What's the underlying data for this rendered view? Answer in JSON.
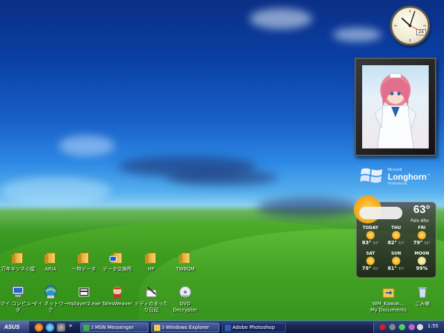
{
  "desktop": {
    "icons_row1": [
      {
        "label": "万年キツネ小屋",
        "icon": "folder-icon"
      },
      {
        "label": "ARIA",
        "icon": "folder-icon"
      },
      {
        "label": "一時データ",
        "icon": "folder-icon"
      },
      {
        "label": "データ交換所",
        "icon": "folder-shortcut-icon"
      },
      {
        "label": "HP",
        "icon": "folder-icon"
      },
      {
        "label": "TWBGM",
        "icon": "folder-icon"
      }
    ],
    "icons_row2": [
      {
        "label": "マイ コンピュータ",
        "icon": "my-computer-icon"
      },
      {
        "label": "マイ ネットワーク",
        "icon": "network-icon"
      },
      {
        "label": "mplayer2.exe",
        "icon": "media-player-icon"
      },
      {
        "label": "TalesWeaver",
        "icon": "talesweaver-icon"
      },
      {
        "label": "ミディのまったり日記",
        "icon": "diary-icon"
      },
      {
        "label": "DVD Decrypter",
        "icon": "dvd-icon"
      }
    ],
    "right_icons": [
      {
        "label": "WM_Kawak... My Documents",
        "icon": "my-documents-icon"
      },
      {
        "label": "ごみ箱",
        "icon": "recycle-bin-icon"
      }
    ]
  },
  "clock_widget": {
    "date": "24"
  },
  "longhorn_logo": {
    "brand_small": "Microsoft",
    "brand_big": "Longhorn",
    "tm": "™",
    "edition": "Professional"
  },
  "weather": {
    "current_temp": "63°",
    "city": "Palo Alto",
    "days": [
      {
        "name": "TODAY",
        "hi": "83°",
        "lo": "54°"
      },
      {
        "name": "THU",
        "hi": "82°",
        "lo": "53°"
      },
      {
        "name": "FRI",
        "hi": "79°",
        "lo": "54°"
      },
      {
        "name": "SAT",
        "hi": "79°",
        "lo": "55°"
      },
      {
        "name": "SUN",
        "hi": "81°",
        "lo": "55°"
      },
      {
        "name": "MOON",
        "hi": "99%",
        "lo": ""
      }
    ]
  },
  "taskbar": {
    "start_label": "ASUS",
    "overflow": "»",
    "tasks": [
      {
        "count": "3",
        "label": "MSN Messenger",
        "active": false
      },
      {
        "count": "3",
        "label": "Windows Explorer",
        "active": false
      },
      {
        "count": "",
        "label": "Adobe Photoshop",
        "active": true
      }
    ],
    "time": "1:55"
  }
}
